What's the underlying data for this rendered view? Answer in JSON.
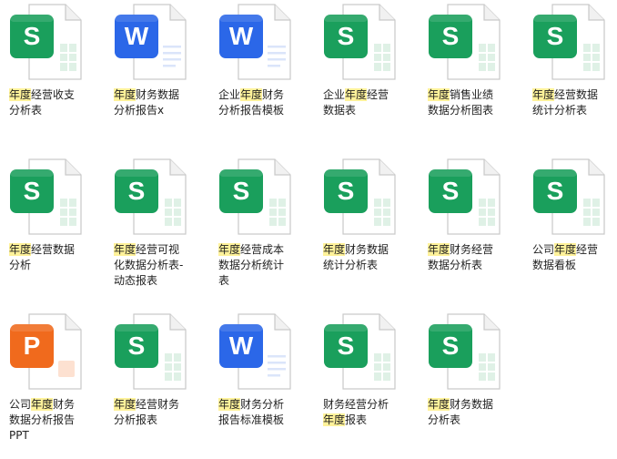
{
  "files": [
    {
      "type": "S",
      "lines": [
        [
          {
            "t": "年度",
            "hl": true
          },
          {
            "t": "经营收支",
            "hl": false
          }
        ],
        [
          {
            "t": "分析表",
            "hl": false
          }
        ]
      ]
    },
    {
      "type": "W",
      "lines": [
        [
          {
            "t": "年度",
            "hl": true
          },
          {
            "t": "财务数据",
            "hl": false
          }
        ],
        [
          {
            "t": "分析报告x",
            "hl": false
          }
        ]
      ]
    },
    {
      "type": "W",
      "lines": [
        [
          {
            "t": "企业",
            "hl": false
          },
          {
            "t": "年度",
            "hl": true
          },
          {
            "t": "财务",
            "hl": false
          }
        ],
        [
          {
            "t": "分析报告模板",
            "hl": false
          }
        ]
      ]
    },
    {
      "type": "S",
      "lines": [
        [
          {
            "t": "企业",
            "hl": false
          },
          {
            "t": "年度",
            "hl": true
          },
          {
            "t": "经营",
            "hl": false
          }
        ],
        [
          {
            "t": "数据表",
            "hl": false
          }
        ]
      ]
    },
    {
      "type": "S",
      "lines": [
        [
          {
            "t": "年度",
            "hl": true
          },
          {
            "t": "销售业绩",
            "hl": false
          }
        ],
        [
          {
            "t": "数据分析图表",
            "hl": false
          }
        ]
      ]
    },
    {
      "type": "S",
      "lines": [
        [
          {
            "t": "年度",
            "hl": true
          },
          {
            "t": "经营数据",
            "hl": false
          }
        ],
        [
          {
            "t": "统计分析表",
            "hl": false
          }
        ]
      ]
    },
    {
      "type": "S",
      "lines": [
        [
          {
            "t": "年度",
            "hl": true
          },
          {
            "t": "经营数据",
            "hl": false
          }
        ],
        [
          {
            "t": "分析",
            "hl": false
          }
        ]
      ]
    },
    {
      "type": "S",
      "lines": [
        [
          {
            "t": "年度",
            "hl": true
          },
          {
            "t": "经营可视",
            "hl": false
          }
        ],
        [
          {
            "t": "化数据分析表-",
            "hl": false
          }
        ],
        [
          {
            "t": "动态报表",
            "hl": false
          }
        ]
      ]
    },
    {
      "type": "S",
      "lines": [
        [
          {
            "t": "年度",
            "hl": true
          },
          {
            "t": "经营成本",
            "hl": false
          }
        ],
        [
          {
            "t": "数据分析统计",
            "hl": false
          }
        ],
        [
          {
            "t": "表",
            "hl": false
          }
        ]
      ]
    },
    {
      "type": "S",
      "lines": [
        [
          {
            "t": "年度",
            "hl": true
          },
          {
            "t": "财务数据",
            "hl": false
          }
        ],
        [
          {
            "t": "统计分析表",
            "hl": false
          }
        ]
      ]
    },
    {
      "type": "S",
      "lines": [
        [
          {
            "t": "年度",
            "hl": true
          },
          {
            "t": "财务经营",
            "hl": false
          }
        ],
        [
          {
            "t": "数据分析表",
            "hl": false
          }
        ]
      ]
    },
    {
      "type": "S",
      "lines": [
        [
          {
            "t": "公司",
            "hl": false
          },
          {
            "t": "年度",
            "hl": true
          },
          {
            "t": "经营",
            "hl": false
          }
        ],
        [
          {
            "t": "数据看板",
            "hl": false
          }
        ]
      ]
    },
    {
      "type": "P",
      "lines": [
        [
          {
            "t": "公司",
            "hl": false
          },
          {
            "t": "年度",
            "hl": true
          },
          {
            "t": "财务",
            "hl": false
          }
        ],
        [
          {
            "t": "数据分析报告",
            "hl": false
          }
        ],
        [
          {
            "t": "PPT",
            "hl": false
          }
        ]
      ]
    },
    {
      "type": "S",
      "lines": [
        [
          {
            "t": "年度",
            "hl": true
          },
          {
            "t": "经营财务",
            "hl": false
          }
        ],
        [
          {
            "t": "分析报表",
            "hl": false
          }
        ]
      ]
    },
    {
      "type": "W",
      "lines": [
        [
          {
            "t": "年度",
            "hl": true
          },
          {
            "t": "财务分析",
            "hl": false
          }
        ],
        [
          {
            "t": "报告标准模板",
            "hl": false
          }
        ]
      ]
    },
    {
      "type": "S",
      "lines": [
        [
          {
            "t": "财务经营分析",
            "hl": false
          }
        ],
        [
          {
            "t": "年度",
            "hl": true
          },
          {
            "t": "报表",
            "hl": false
          }
        ]
      ]
    },
    {
      "type": "S",
      "lines": [
        [
          {
            "t": "年度",
            "hl": true
          },
          {
            "t": "财务数据",
            "hl": false
          }
        ],
        [
          {
            "t": "分析表",
            "hl": false
          }
        ]
      ]
    }
  ],
  "colors": {
    "S": "#1a9f5c",
    "W": "#2b67e8",
    "P": "#f06a1d",
    "highlight": "#fff29a"
  },
  "icons": {
    "S": "spreadsheet-file-icon",
    "W": "word-document-file-icon",
    "P": "powerpoint-file-icon"
  }
}
